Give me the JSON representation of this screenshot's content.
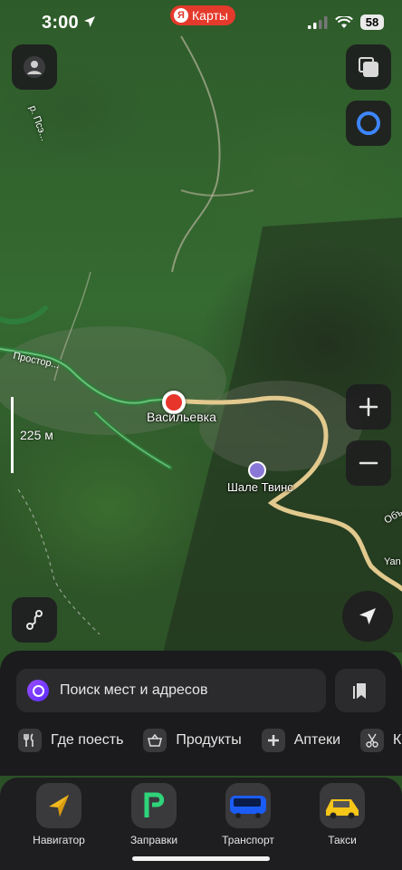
{
  "status_bar": {
    "time": "3:00",
    "battery": "58"
  },
  "app_badge": {
    "logo": "Я",
    "label": "Карты"
  },
  "map": {
    "place_label": "Васильевка",
    "poi_label": "Шале Твинс",
    "street_label": "Простор...",
    "river_label": "р. Псэ...",
    "edge_label_1": "Объ",
    "edge_label_2": "Yan",
    "scale": "225 м"
  },
  "search": {
    "placeholder": "Поиск мест и адресов"
  },
  "categories": [
    {
      "label": "Где поесть",
      "icon": "fork-knife-icon"
    },
    {
      "label": "Продукты",
      "icon": "basket-icon"
    },
    {
      "label": "Аптеки",
      "icon": "plus-icon"
    },
    {
      "label": "Кр",
      "icon": "scissors-icon"
    }
  ],
  "dock": [
    {
      "label": "Навигатор",
      "icon": "navigator-icon"
    },
    {
      "label": "Заправки",
      "icon": "fuel-icon"
    },
    {
      "label": "Транспорт",
      "icon": "bus-icon"
    },
    {
      "label": "Такси",
      "icon": "taxi-icon"
    }
  ],
  "colors": {
    "road_green": "#2f7d3a",
    "road_yellow": "#e2c98e",
    "pin_red": "#e8352b",
    "accent_red": "#e43a2c"
  }
}
